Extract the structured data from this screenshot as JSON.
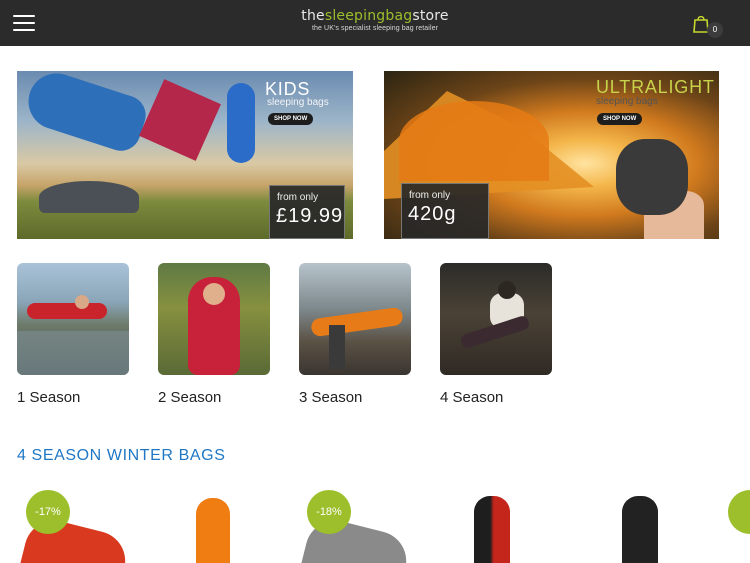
{
  "header": {
    "logo_prefix": "the",
    "logo_highlight": "sleepingbag",
    "logo_suffix": "store",
    "tagline": "the UK's specialist sleeping bag retailer",
    "cart_count": "0"
  },
  "banners": [
    {
      "title": "KIDS",
      "subtitle": "sleeping bags",
      "cta": "SHOP NOW",
      "price_prefix": "from only",
      "price": "£19.99"
    },
    {
      "title": "ULTRALIGHT",
      "subtitle": "sleeping bags",
      "cta": "SHOP NOW",
      "price_prefix": "from only",
      "price": "420g"
    }
  ],
  "seasons": [
    {
      "label": "1 Season"
    },
    {
      "label": "2 Season"
    },
    {
      "label": "3 Season"
    },
    {
      "label": "4 Season"
    }
  ],
  "section": {
    "title": "4 SEASON WINTER BAGS"
  },
  "products": [
    {
      "badge": "-17%",
      "color": "#d8391f"
    },
    {
      "badge": "",
      "color": "#ef7d12"
    },
    {
      "badge": "-18%",
      "color": "#8a8a8a"
    },
    {
      "badge": "",
      "color": "#c4261c"
    },
    {
      "badge": "",
      "color": "#222222"
    }
  ],
  "colors": {
    "header_bg": "#2b2b2b",
    "accent_green": "#9cbf2b",
    "link_blue": "#1f77c4"
  }
}
